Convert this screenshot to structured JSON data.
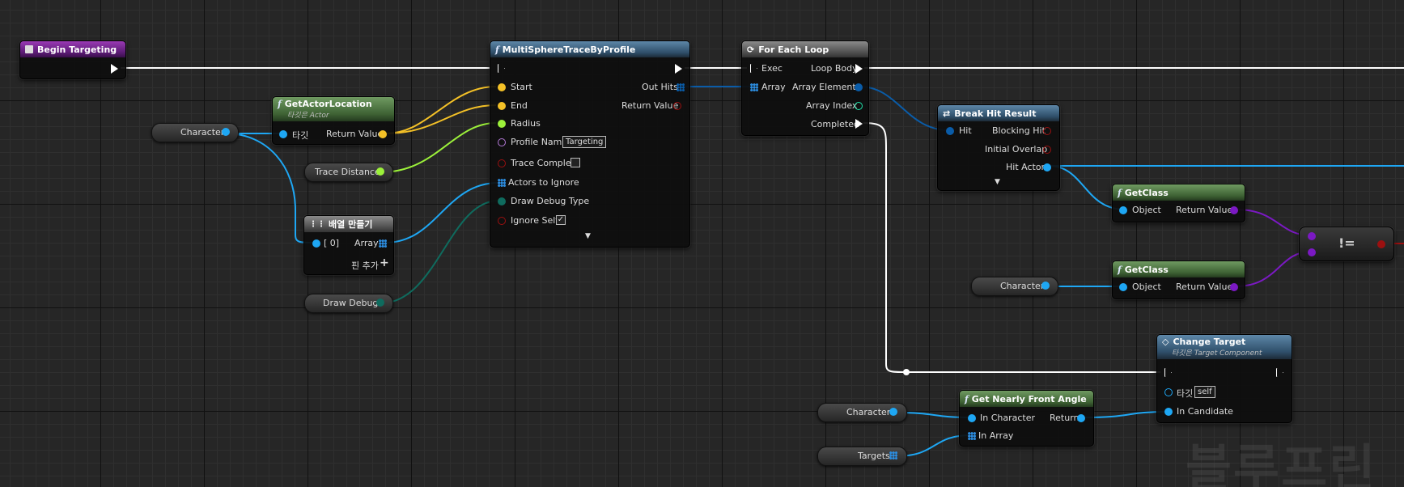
{
  "watermark": "블루프린",
  "nodes": {
    "begin_targeting": {
      "title": "Begin Targeting"
    },
    "multi_trace": {
      "title": "MultiSphereTraceByProfile",
      "start": "Start",
      "end": "End",
      "radius": "Radius",
      "profile_name": "Profile Name",
      "profile_value": "Targeting",
      "trace_complex": "Trace Complex",
      "actors_to_ignore": "Actors to Ignore",
      "draw_debug_type": "Draw Debug Type",
      "ignore_self": "Ignore Self",
      "out_hits": "Out Hits",
      "return_value": "Return Value",
      "ignore_self_checked": "✓"
    },
    "for_each": {
      "title": "For Each Loop",
      "exec": "Exec",
      "array": "Array",
      "loop_body": "Loop Body",
      "array_element": "Array Element",
      "array_index": "Array Index",
      "completed": "Completed"
    },
    "get_actor_location": {
      "title": "GetActorLocation",
      "subtitle": "타깃은 Actor",
      "target": "타깃",
      "return_value": "Return Value"
    },
    "break_hit": {
      "title": "Break Hit Result",
      "hit": "Hit",
      "blocking_hit": "Blocking Hit",
      "initial_overlap": "Initial Overlap",
      "hit_actor": "Hit Actor"
    },
    "get_class_1": {
      "title": "GetClass",
      "object": "Object",
      "return_value": "Return Value"
    },
    "get_class_2": {
      "title": "GetClass",
      "object": "Object",
      "return_value": "Return Value"
    },
    "not_equal": {
      "op": "!="
    },
    "make_array": {
      "title": "배열 만들기",
      "index0": "[ 0]",
      "array": "Array",
      "add_pin": "핀 추가"
    },
    "change_target": {
      "title": "Change Target",
      "subtitle": "타깃은 Target Component",
      "target": "타깃",
      "self": "self",
      "in_candidate": "In Candidate"
    },
    "nearly_front": {
      "title": "Get Nearly Front Angle",
      "in_character": "In Character",
      "in_array": "In Array",
      "return": "Return"
    }
  },
  "variables": {
    "character_1": "Character",
    "trace_distance": "Trace Distance",
    "draw_debug": "Draw Debug",
    "character_2": "Character",
    "character_3": "Character",
    "targets": "Targets"
  },
  "colors": {
    "exec": "#ffffff",
    "vector": "#f4c127",
    "float": "#9cf13a",
    "object": "#1ea7f4",
    "struct": "#0a5ca8",
    "class": "#7b19c3",
    "int": "#1fe3a9",
    "enum": "#0f6b5e",
    "bool": "#9b1010",
    "name": "#b57ad9"
  }
}
